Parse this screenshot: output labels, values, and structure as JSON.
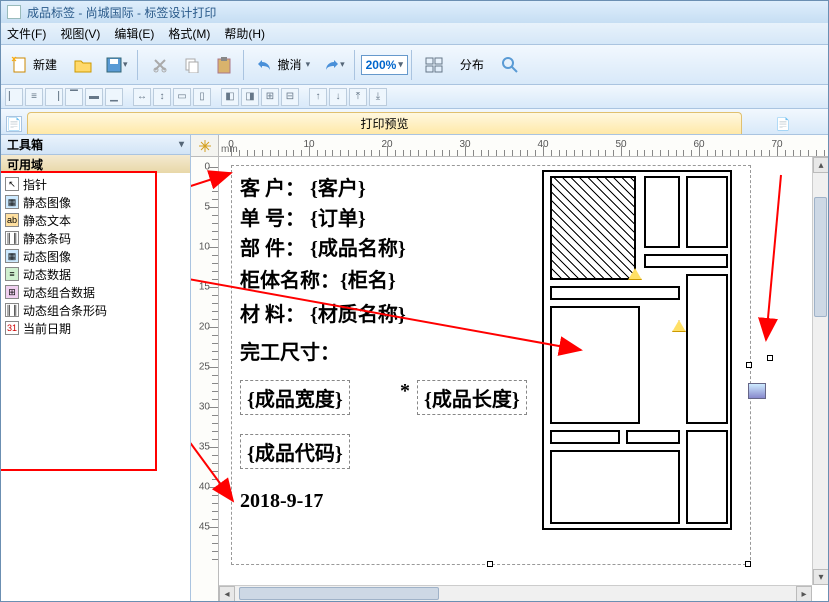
{
  "titlebar": {
    "title": "成品标签 - 尚城国际 - 标签设计打印"
  },
  "menu": {
    "file": "文件(F)",
    "view": "视图(V)",
    "edit": "编辑(E)",
    "format": "格式(M)",
    "help": "帮助(H)"
  },
  "toolbar": {
    "new": "新建",
    "undo": "撤消",
    "zoom": "200%",
    "distribute": "分布"
  },
  "tab": {
    "preview": "打印预览"
  },
  "sidebar": {
    "toolbox": "工具箱",
    "fields": "可用域",
    "items": {
      "pointer": "指针",
      "staticImage": "静态图像",
      "staticText": "静态文本",
      "staticBarcode": "静态条码",
      "dynImage": "动态图像",
      "dynData": "动态数据",
      "dynCombo": "动态组合数据",
      "dynComboBarcode": "动态组合条形码",
      "currentDate": "当前日期"
    }
  },
  "ruler": {
    "unit": "mm",
    "h": [
      "0",
      "10",
      "20",
      "30",
      "40",
      "50",
      "60",
      "70"
    ],
    "v": [
      "0",
      "5",
      "10",
      "15",
      "20",
      "25",
      "30",
      "35",
      "40",
      "45"
    ]
  },
  "label": {
    "row1": "客    户：  {客户}",
    "row2": "单    号：  {订单}",
    "row3": "部    件：  {成品名称}",
    "row4": "柜体名称：{柜名}",
    "row5": "材    料：  {材质名称}",
    "row6": "完工尺寸：",
    "row7a": "{成品宽度}",
    "row7star": "*",
    "row7b": "{成品长度}",
    "row8": "{成品代码}",
    "row9": "2018-9-17"
  }
}
